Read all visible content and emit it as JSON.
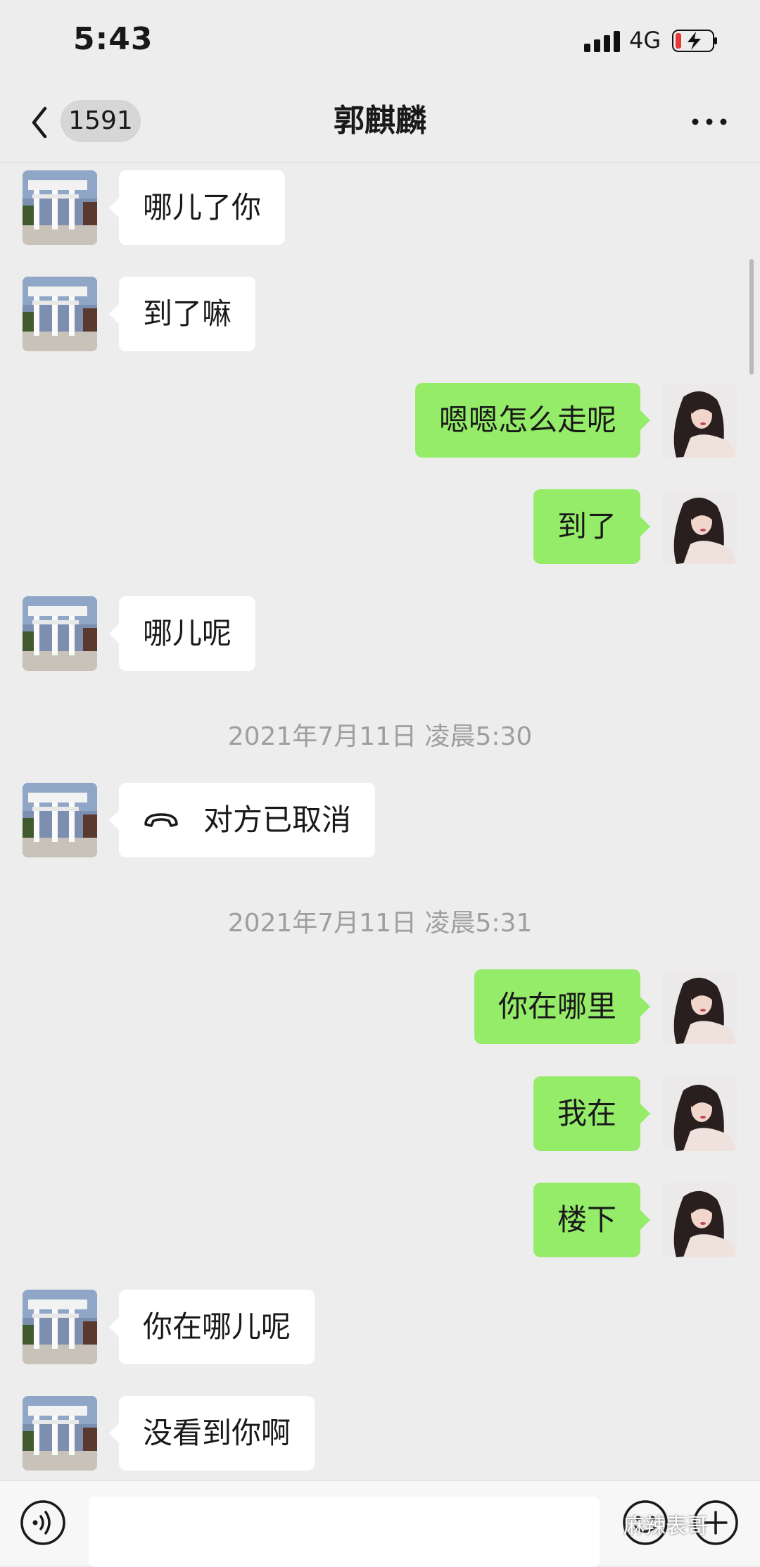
{
  "status_bar": {
    "time": "5:43",
    "network": "4G"
  },
  "header": {
    "unread_count": "1591",
    "contact_name": "郭麒麟"
  },
  "messages": [
    {
      "side": "left",
      "text": "哪儿了你"
    },
    {
      "side": "left",
      "text": "到了嘛"
    },
    {
      "side": "right",
      "text": "嗯嗯怎么走呢"
    },
    {
      "side": "right",
      "text": "到了"
    },
    {
      "side": "left",
      "text": "哪儿呢"
    },
    {
      "timestamp": "2021年7月11日 凌晨5:30"
    },
    {
      "side": "left",
      "type": "call",
      "text": "对方已取消"
    },
    {
      "timestamp": "2021年7月11日 凌晨5:31"
    },
    {
      "side": "right",
      "text": "你在哪里"
    },
    {
      "side": "right",
      "text": "我在"
    },
    {
      "side": "right",
      "text": "楼下"
    },
    {
      "side": "left",
      "text": "你在哪儿呢"
    },
    {
      "side": "left",
      "text": "没看到你啊"
    }
  ],
  "input_bar": {
    "placeholder": ""
  },
  "watermark": "麻辣表哥",
  "colors": {
    "background": "#ededed",
    "sent_bubble": "#95ec69",
    "received_bubble": "#ffffff",
    "timestamp_text": "#9e9e9e"
  },
  "icons": [
    "back-chevron-icon",
    "more-dots-icon",
    "phone-call-icon",
    "voice-icon",
    "emoji-icon",
    "plus-icon",
    "signal-icon",
    "battery-charging-icon"
  ]
}
